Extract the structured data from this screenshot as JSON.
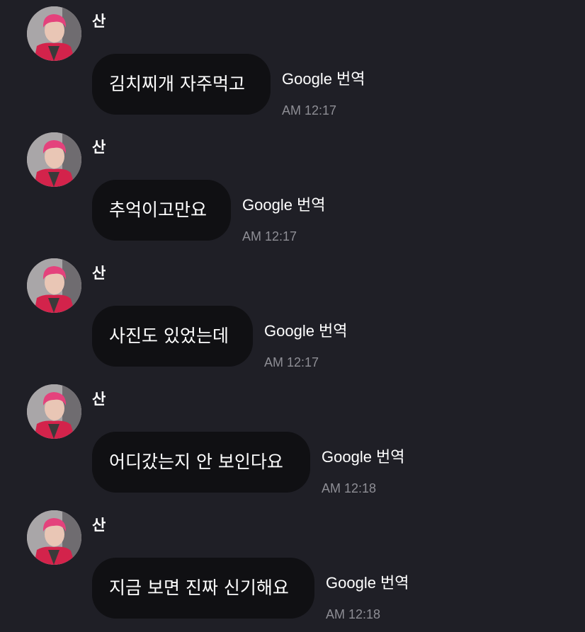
{
  "colors": {
    "background": "#1f1f26",
    "bubble": "#101013",
    "text": "#ffffff",
    "timestamp": "#8e8e95"
  },
  "messages": [
    {
      "sender": "산",
      "text": "김치찌개 자주먹고",
      "translate_label": "Google 번역",
      "time": "AM 12:17"
    },
    {
      "sender": "산",
      "text": "추억이고만요",
      "translate_label": "Google 번역",
      "time": "AM 12:17"
    },
    {
      "sender": "산",
      "text": "사진도 있었는데",
      "translate_label": "Google 번역",
      "time": "AM 12:17"
    },
    {
      "sender": "산",
      "text": "어디갔는지 안 보인다요",
      "translate_label": "Google 번역",
      "time": "AM 12:18"
    },
    {
      "sender": "산",
      "text": "지금 보면 진짜 신기해요",
      "translate_label": "Google 번역",
      "time": "AM 12:18"
    }
  ]
}
